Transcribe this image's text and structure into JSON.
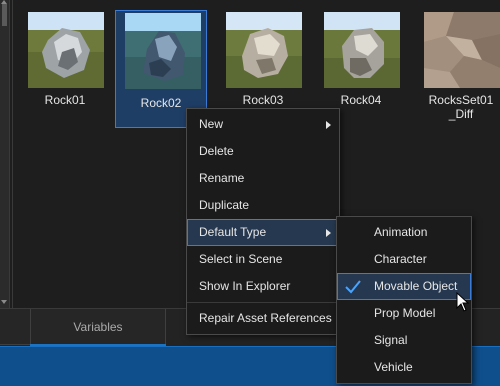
{
  "assets": [
    {
      "label": "Rock01"
    },
    {
      "label": "Rock02"
    },
    {
      "label": "Rock03"
    },
    {
      "label": "Rock04"
    },
    {
      "label": "RocksSet01\n_Diff"
    }
  ],
  "tabs": [
    {
      "label": ""
    },
    {
      "label": "Variables"
    }
  ],
  "context_menu": {
    "items": [
      "New",
      "Delete",
      "Rename",
      "Duplicate",
      "Default Type",
      "Select in Scene",
      "Show In Explorer",
      "Repair Asset References"
    ]
  },
  "submenu": {
    "items": [
      "Animation",
      "Character",
      "Movable Object",
      "Prop Model",
      "Signal",
      "Vehicle"
    ]
  },
  "colors": {
    "accent": "#3b7bd8",
    "selection_bg": "#1f3e66",
    "status_bar": "#0f4f8c"
  }
}
